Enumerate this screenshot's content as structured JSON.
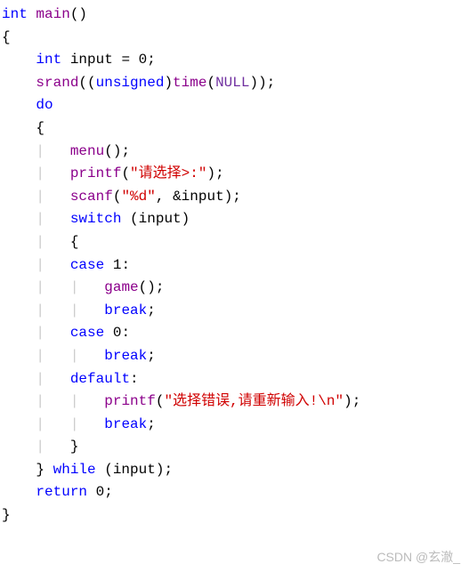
{
  "code": {
    "l1_int": "int",
    "l1_main": "main",
    "l1_paren": "()",
    "l2_brace": "{",
    "l3_int": "int",
    "l3_input": "input",
    "l3_eq": " = ",
    "l3_zero": "0",
    "l3_semi": ";",
    "l4_srand": "srand",
    "l4_open": "((",
    "l4_unsigned": "unsigned",
    "l4_close1": ")",
    "l4_time": "time",
    "l4_open2": "(",
    "l4_null": "NULL",
    "l4_close2": "));",
    "l5_do": "do",
    "l6_brace": "{",
    "l7_menu": "menu",
    "l7_paren": "();",
    "l8_printf": "printf",
    "l8_open": "(",
    "l8_str": "\"请选择>:\"",
    "l8_close": ");",
    "l9_scanf": "scanf",
    "l9_open": "(",
    "l9_str": "\"%d\"",
    "l9_comma": ", &",
    "l9_input": "input",
    "l9_close": ");",
    "l10_switch": "switch",
    "l10_open": " (",
    "l10_input": "input",
    "l10_close": ")",
    "l11_brace": "{",
    "l12_case": "case",
    "l12_num": " 1",
    "l12_colon": ":",
    "l13_game": "game",
    "l13_paren": "();",
    "l14_break": "break",
    "l14_semi": ";",
    "l15_case": "case",
    "l15_num": " 0",
    "l15_colon": ":",
    "l16_break": "break",
    "l16_semi": ";",
    "l17_default": "default",
    "l17_colon": ":",
    "l18_printf": "printf",
    "l18_open": "(",
    "l18_str": "\"选择错误,请重新输入!",
    "l18_esc": "\\n",
    "l18_strend": "\"",
    "l18_close": ");",
    "l19_break": "break",
    "l19_semi": ";",
    "l20_brace": "}",
    "l21_brace": "}",
    "l21_while": " while",
    "l21_open": " (",
    "l21_input": "input",
    "l21_close": ");",
    "l22_return": "return",
    "l22_num": " 0",
    "l22_semi": ";",
    "l23_brace": "}"
  },
  "watermark": "CSDN @玄澈_"
}
